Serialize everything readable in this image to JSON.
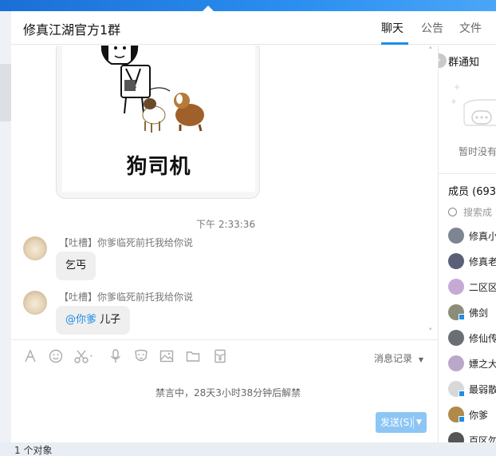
{
  "window": {
    "title": "修真江湖官方1群"
  },
  "tabs": [
    {
      "label": "聊天",
      "active": true
    },
    {
      "label": "公告",
      "active": false
    },
    {
      "label": "文件",
      "active": false
    }
  ],
  "chat": {
    "sticker_caption": "狗司机",
    "timestamp": "下午 2:33:36",
    "messages": [
      {
        "sender": "【吐槽】你爹临死前托我给你说",
        "text": "乞丐",
        "mention": ""
      },
      {
        "sender": "【吐槽】你爹临死前托我给你说",
        "text": "儿子",
        "mention": "@你爹"
      }
    ]
  },
  "toolbar": {
    "icons": [
      "font-icon",
      "emoji-icon",
      "scissors-icon",
      "microphone-icon",
      "mask-icon",
      "image-icon",
      "folder-icon",
      "red-packet-icon"
    ],
    "history_label": "消息记录"
  },
  "composer": {
    "banned_notice": "禁言中，28天3小时38分钟后解禁",
    "send_label": "发送(S)"
  },
  "sidebar": {
    "notice_title": "群通知",
    "notice_empty": "暂时没有",
    "members_title": "成员 (693",
    "search_placeholder": "搜索成",
    "members": [
      {
        "name": "修真小",
        "color": "#7d8590",
        "device": false
      },
      {
        "name": "修真老",
        "color": "#5a5f78",
        "device": false
      },
      {
        "name": "二区区",
        "color": "#c7a9d6",
        "device": false
      },
      {
        "name": "佛剑",
        "color": "#8c8c7a",
        "device": true
      },
      {
        "name": "修仙传",
        "color": "#6b6f75",
        "device": false
      },
      {
        "name": "嫖之大",
        "color": "#b9a8c8",
        "device": false
      },
      {
        "name": "最弱散",
        "color": "#d8d8d8",
        "device": true
      },
      {
        "name": "你爹",
        "color": "#b08a4a",
        "device": true
      },
      {
        "name": "百区勿",
        "color": "#555555",
        "device": false
      }
    ]
  },
  "status_bar": {
    "text": "1 个对象"
  },
  "colors": {
    "accent": "#1e8ee8",
    "send_button": "#8dc6f5",
    "bubble": "#efefef"
  }
}
